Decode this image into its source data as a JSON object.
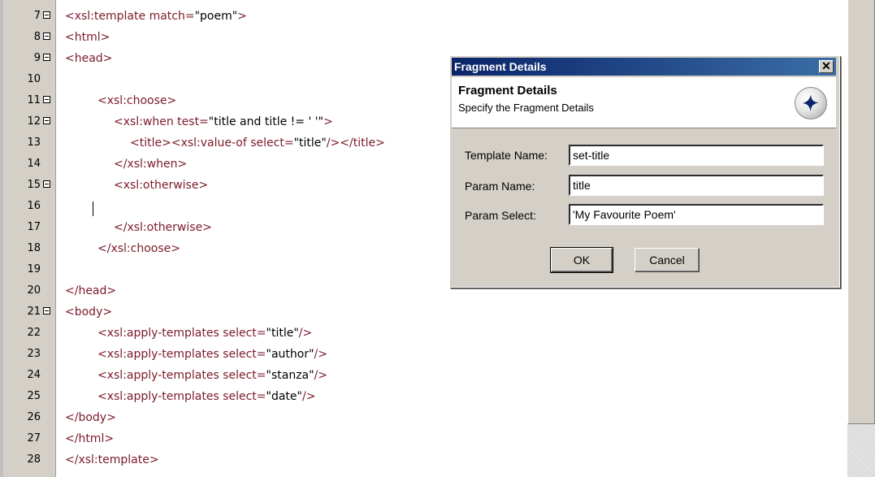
{
  "editor": {
    "lines": [
      {
        "num": "7",
        "fold": true,
        "indent": 0,
        "parts": [
          [
            "t",
            "<xsl:template match="
          ],
          [
            "val",
            "\"poem\""
          ],
          [
            "t",
            ">"
          ]
        ]
      },
      {
        "num": "8",
        "fold": true,
        "indent": 0,
        "parts": [
          [
            "t",
            "<html>"
          ]
        ]
      },
      {
        "num": "9",
        "fold": true,
        "indent": 0,
        "parts": [
          [
            "t",
            "<head>"
          ]
        ]
      },
      {
        "num": "10",
        "fold": false,
        "indent": 0,
        "parts": []
      },
      {
        "num": "11",
        "fold": true,
        "indent": 2,
        "parts": [
          [
            "t",
            "<xsl:choose>"
          ]
        ]
      },
      {
        "num": "12",
        "fold": true,
        "indent": 3,
        "parts": [
          [
            "t",
            "<xsl:when test="
          ],
          [
            "val",
            "\"title and title != ' '\""
          ],
          [
            "t",
            ">"
          ]
        ]
      },
      {
        "num": "13",
        "fold": false,
        "indent": 4,
        "parts": [
          [
            "t",
            "<title><xsl:value-of select="
          ],
          [
            "val",
            "\"title\""
          ],
          [
            "t",
            "/></title>"
          ]
        ]
      },
      {
        "num": "14",
        "fold": false,
        "indent": 3,
        "parts": [
          [
            "t",
            "</xsl:when>"
          ]
        ]
      },
      {
        "num": "15",
        "fold": true,
        "indent": 3,
        "parts": [
          [
            "t",
            "<xsl:otherwise>"
          ]
        ]
      },
      {
        "num": "16",
        "fold": false,
        "indent": 0,
        "parts": []
      },
      {
        "num": "17",
        "fold": false,
        "indent": 3,
        "parts": [
          [
            "t",
            "</xsl:otherwise>"
          ]
        ]
      },
      {
        "num": "18",
        "fold": false,
        "indent": 2,
        "parts": [
          [
            "t",
            "</xsl:choose>"
          ]
        ]
      },
      {
        "num": "19",
        "fold": false,
        "indent": 0,
        "parts": []
      },
      {
        "num": "20",
        "fold": false,
        "indent": 0,
        "parts": [
          [
            "t",
            "</head>"
          ]
        ]
      },
      {
        "num": "21",
        "fold": true,
        "indent": 0,
        "parts": [
          [
            "t",
            "<body>"
          ]
        ]
      },
      {
        "num": "22",
        "fold": false,
        "indent": 2,
        "parts": [
          [
            "t",
            "<xsl:apply-templates select="
          ],
          [
            "val",
            "\"title\""
          ],
          [
            "t",
            "/>"
          ]
        ]
      },
      {
        "num": "23",
        "fold": false,
        "indent": 2,
        "parts": [
          [
            "t",
            "<xsl:apply-templates select="
          ],
          [
            "val",
            "\"author\""
          ],
          [
            "t",
            "/>"
          ]
        ]
      },
      {
        "num": "24",
        "fold": false,
        "indent": 2,
        "parts": [
          [
            "t",
            "<xsl:apply-templates select="
          ],
          [
            "val",
            "\"stanza\""
          ],
          [
            "t",
            "/>"
          ]
        ]
      },
      {
        "num": "25",
        "fold": false,
        "indent": 2,
        "parts": [
          [
            "t",
            "<xsl:apply-templates select="
          ],
          [
            "val",
            "\"date\""
          ],
          [
            "t",
            "/>"
          ]
        ]
      },
      {
        "num": "26",
        "fold": false,
        "indent": 0,
        "parts": [
          [
            "t",
            "</body>"
          ]
        ]
      },
      {
        "num": "27",
        "fold": false,
        "indent": 0,
        "parts": [
          [
            "t",
            "</html>"
          ]
        ]
      },
      {
        "num": "28",
        "fold": false,
        "indent": 0,
        "parts": [
          [
            "t",
            "</xsl:template>"
          ]
        ]
      }
    ],
    "colors": {
      "tag": "#7a1a2a",
      "text": "#000000",
      "gutter": "#d4d0c8"
    }
  },
  "dialog": {
    "title": "Fragment Details",
    "close_label": "✕",
    "header_title": "Fragment Details",
    "header_subtitle": "Specify the Fragment Details",
    "fields": {
      "template_name": {
        "label": "Template Name:",
        "value": "set-title"
      },
      "param_name": {
        "label": "Param Name:",
        "value": "title"
      },
      "param_select": {
        "label": "Param Select:",
        "value": "'My Favourite Poem'"
      }
    },
    "ok_label": "OK",
    "cancel_label": "Cancel",
    "titlebar_color": "#0a246a"
  }
}
